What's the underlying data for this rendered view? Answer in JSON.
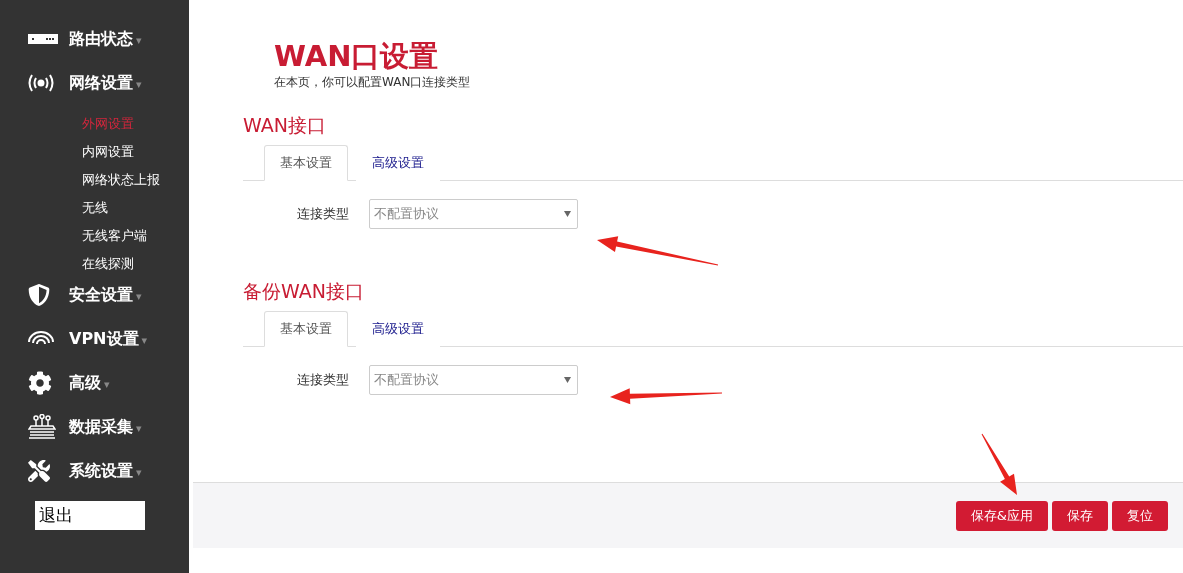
{
  "sidebar": {
    "menu": [
      {
        "label": "路由状态",
        "caret": "▾"
      },
      {
        "label": "网络设置",
        "caret": "▾",
        "children": [
          {
            "label": "外网设置",
            "selected": true
          },
          {
            "label": "内网设置",
            "selected": false
          },
          {
            "label": "网络状态上报",
            "selected": false
          },
          {
            "label": "无线",
            "selected": false
          },
          {
            "label": "无线客户端",
            "selected": false
          },
          {
            "label": "在线探测",
            "selected": false
          }
        ]
      },
      {
        "label": "安全设置",
        "caret": "▾"
      },
      {
        "label": "VPN设置",
        "caret": "▾"
      },
      {
        "label": "高级",
        "caret": "▾"
      },
      {
        "label": "数据采集",
        "caret": "▾"
      },
      {
        "label": "系统设置",
        "caret": "▾"
      }
    ],
    "logout": "退出"
  },
  "page": {
    "title": "WAN口设置",
    "subtitle": "在本页，你可以配置WAN口连接类型"
  },
  "sections": [
    {
      "title": "WAN接口",
      "tabs": [
        {
          "label": "基本设置",
          "selected": true
        },
        {
          "label": "高级设置",
          "selected": false
        }
      ],
      "fields": [
        {
          "label": "连接类型",
          "value": "不配置协议"
        }
      ]
    },
    {
      "title": "备份WAN接口",
      "tabs": [
        {
          "label": "基本设置",
          "selected": true
        },
        {
          "label": "高级设置",
          "selected": false
        }
      ],
      "fields": [
        {
          "label": "连接类型",
          "value": "不配置协议"
        }
      ]
    }
  ],
  "buttons": [
    "保存&应用",
    "保存",
    "复位"
  ]
}
